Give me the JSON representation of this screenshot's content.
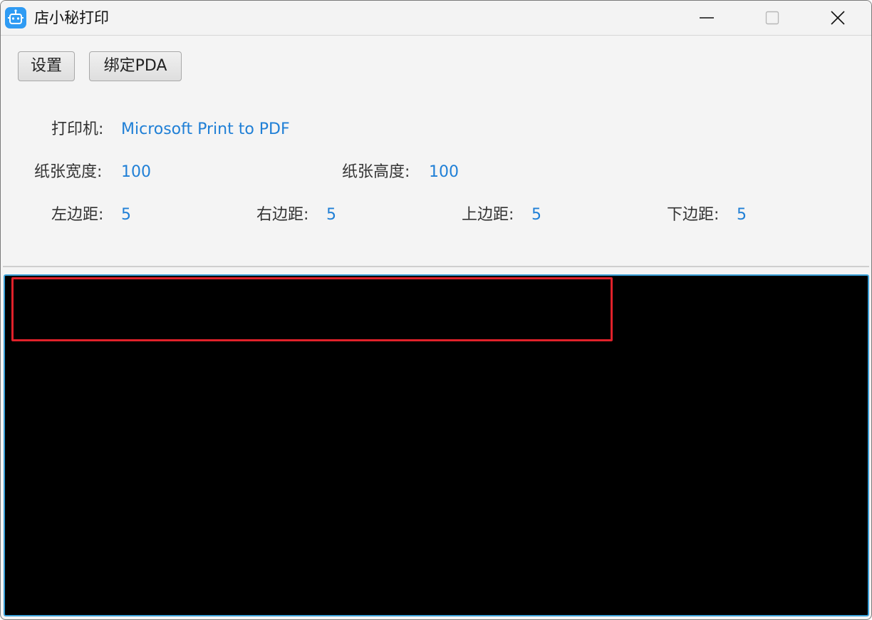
{
  "window": {
    "title": "店小秘打印",
    "icon": "robot-icon",
    "controls": [
      "minimize-icon",
      "maximize-icon",
      "close-icon"
    ]
  },
  "toolbar": {
    "settings_label": "设置",
    "bind_pda_label": "绑定PDA"
  },
  "settings": {
    "printer": {
      "label": "打印机:",
      "value": "Microsoft Print to PDF"
    },
    "paper_width": {
      "label": "纸张宽度:",
      "value": "100"
    },
    "paper_height": {
      "label": "纸张高度:",
      "value": "100"
    },
    "margin_left": {
      "label": "左边距:",
      "value": "5"
    },
    "margin_right": {
      "label": "右边距:",
      "value": "5"
    },
    "margin_top": {
      "label": "上边距:",
      "value": "5"
    },
    "margin_bottom": {
      "label": "下边距:",
      "value": "5"
    }
  },
  "colors": {
    "accent": "#1f7fd6",
    "preview_background": "#000000",
    "print_area_border": "#e0212a",
    "preview_border": "#3aa0d8"
  }
}
